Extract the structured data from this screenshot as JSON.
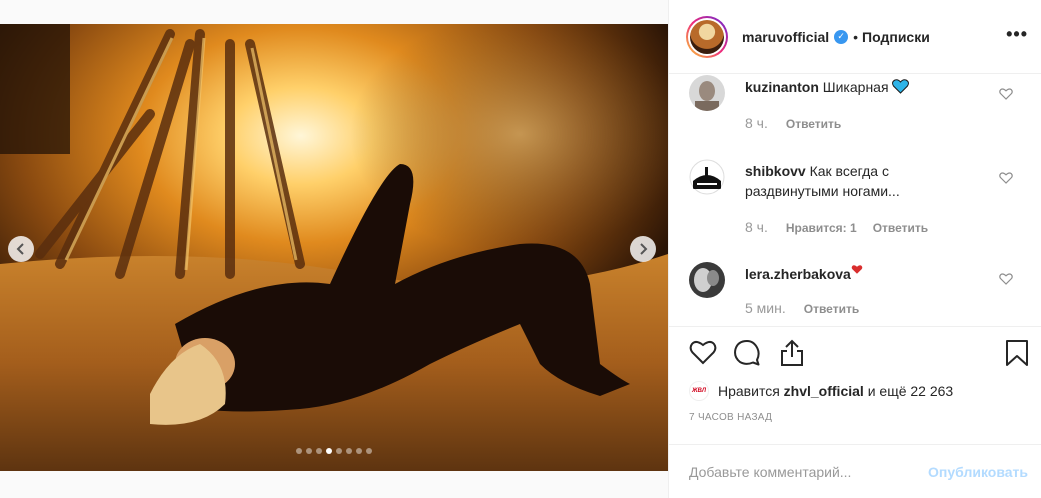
{
  "post": {
    "username": "maruvofficial",
    "follow_label": "Подписки",
    "separator": "•",
    "more_glyph": "•••",
    "verified_glyph": "✓",
    "carousel": {
      "slide_count": 8,
      "active_index": 3
    }
  },
  "comments": [
    {
      "username": "kuzinanton",
      "text": "Шикарная",
      "emoji": "blue-heart",
      "time": "8 ч.",
      "reply_label": "Ответить",
      "likes_label": ""
    },
    {
      "username": "shibkovv",
      "text": "Как всегда с раздвинутыми ногами...",
      "emoji": "",
      "time": "8 ч.",
      "reply_label": "Ответить",
      "likes_label": "Нравится: 1"
    },
    {
      "username": "lera.zherbakova",
      "text": "",
      "emoji": "red-heart",
      "time": "5 мин.",
      "reply_label": "Ответить",
      "likes_label": ""
    }
  ],
  "likes": {
    "prefix": "Нравится",
    "user": "zhvl_official",
    "suffix": "и ещё 22 263",
    "avatar_text": "ЖВЛ"
  },
  "time_ago": "7 ЧАСОВ НАЗАД",
  "add_comment": {
    "placeholder": "Добавьте комментарий...",
    "publish_label": "Опубликовать"
  },
  "colors": {
    "verified": "#3897f0",
    "publish_disabled": "#b3dbff",
    "muted_text": "#8e8e8e",
    "blue_heart": "#2fb4e8",
    "red_heart": "#d92e2e"
  }
}
